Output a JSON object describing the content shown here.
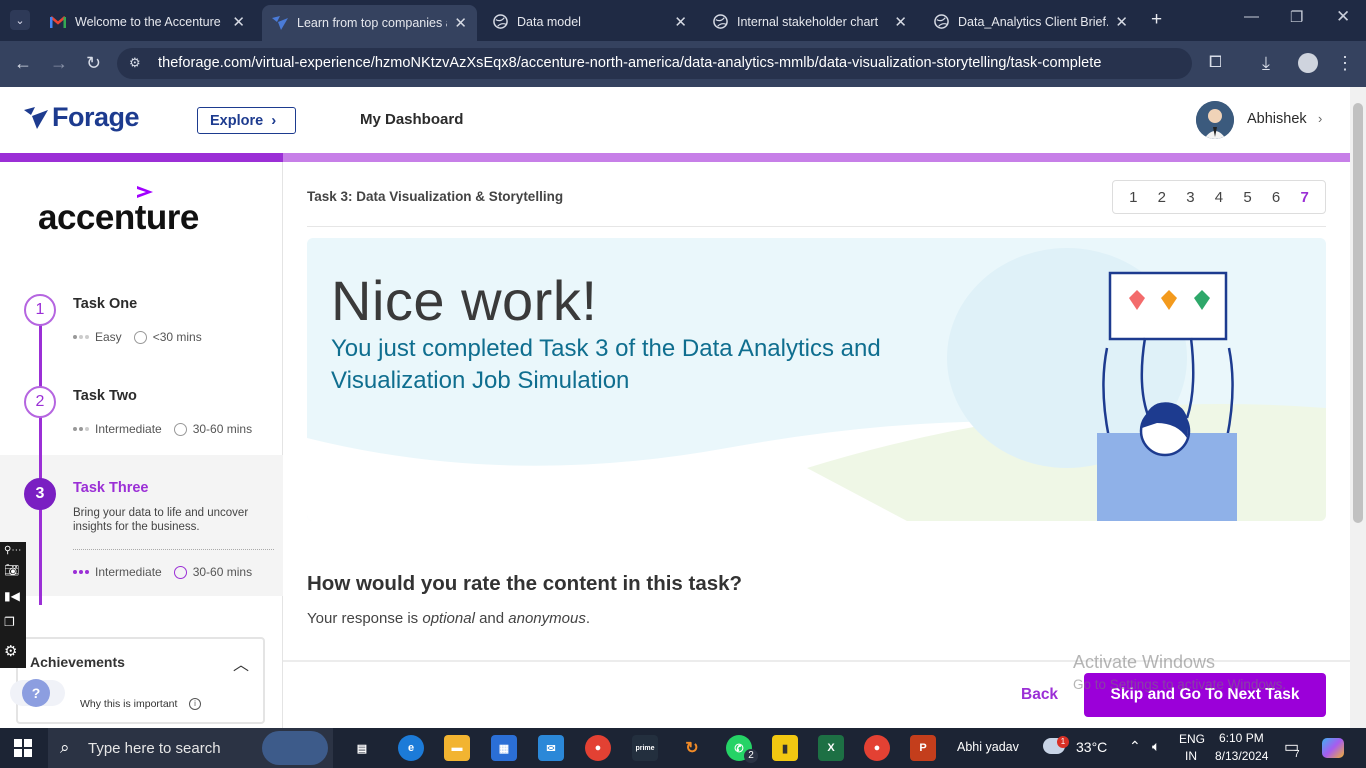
{
  "browser": {
    "tabs": [
      {
        "label": "Welcome to the Accenture N",
        "icon": "gmail-icon",
        "active": false
      },
      {
        "label": "Learn from top companies a",
        "icon": "forage-icon",
        "active": true
      },
      {
        "label": "Data model",
        "icon": "globe-icon",
        "active": false
      },
      {
        "label": "Internal stakeholder chart",
        "icon": "globe-icon",
        "active": false
      },
      {
        "label": "Data_Analytics Client Brief.p",
        "icon": "globe-icon",
        "active": false
      }
    ],
    "new_tab": "+",
    "url": "theforage.com/virtual-experience/hzmoNKtzvAzXsEqx8/accenture-north-america/data-analytics-mmlb/data-visualization-storytelling/task-complete"
  },
  "header": {
    "logo_text": "Forage",
    "explore_label": "Explore",
    "dashboard_label": "My Dashboard",
    "user_name": "Abhishek"
  },
  "sidebar": {
    "company": "accenture",
    "tasks": [
      {
        "num": "1",
        "title": "Task One",
        "level": "Easy",
        "time": "<30 mins"
      },
      {
        "num": "2",
        "title": "Task Two",
        "level": "Intermediate",
        "time": "30-60 mins"
      },
      {
        "num": "3",
        "title": "Task Three",
        "description": "Bring your data to life and uncover insights for the business.",
        "level": "Intermediate",
        "time": "30-60 mins"
      }
    ],
    "achievements_title": "Achievements",
    "why_label": "Why this is important",
    "help_glyph": "?"
  },
  "main": {
    "task_header": "Task 3: Data Visualization & Storytelling",
    "pages": [
      "1",
      "2",
      "3",
      "4",
      "5",
      "6",
      "7"
    ],
    "current_page": "7",
    "hero_title": "Nice work!",
    "hero_subtitle": "You just completed Task 3 of the Data Analytics and Visualization Job Simulation",
    "rating_question": "How would you rate the content in this task?",
    "rating_sub_prefix": "Your response is ",
    "rating_sub_optional": "optional",
    "rating_sub_and": " and ",
    "rating_sub_anonymous": "anonymous",
    "rating_sub_suffix": ".",
    "back_label": "Back",
    "next_label": "Skip and Go To Next Task"
  },
  "watermark": {
    "line1": "Activate Windows",
    "line2": "Go to Settings to activate Windows."
  },
  "taskbar": {
    "search_placeholder": "Type here to search",
    "user": "Abhi yadav",
    "weather": "33°C",
    "weather_badge": "1",
    "lang1": "ENG",
    "lang2": "IN",
    "time": "6:10 PM",
    "date": "8/13/2024",
    "notifications": "7",
    "whatsapp_badge": "2"
  },
  "colors": {
    "brand_purple": "#9b2fd6",
    "button_purple": "#9b00d9",
    "forage_blue": "#1d3b8f",
    "hero_bg": "#eaf7fb",
    "subtitle_teal": "#0f6e8f"
  }
}
